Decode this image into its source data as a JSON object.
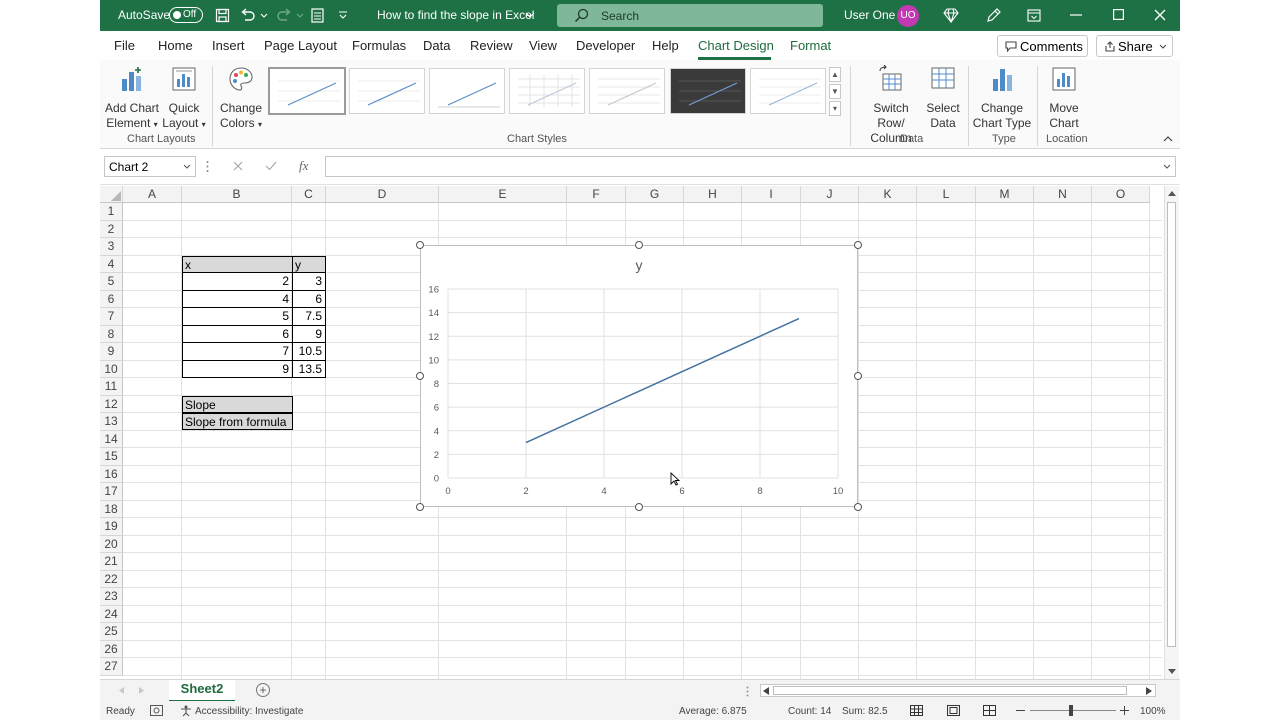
{
  "titlebar": {
    "autosave_label": "AutoSave",
    "autosave_state": "Off",
    "doc_title": "How to find the slope in Excel",
    "search_placeholder": "Search",
    "user_name": "User One",
    "user_initials": "UO"
  },
  "menu": {
    "tabs": [
      "File",
      "Home",
      "Insert",
      "Page Layout",
      "Formulas",
      "Data",
      "Review",
      "View",
      "Developer",
      "Help",
      "Chart Design",
      "Format"
    ],
    "active_tab": "Chart Design",
    "comments_label": "Comments",
    "share_label": "Share"
  },
  "ribbon": {
    "add_chart_element": [
      "Add Chart",
      "Element"
    ],
    "quick_layout": [
      "Quick",
      "Layout"
    ],
    "change_colors": [
      "Change",
      "Colors"
    ],
    "switch_row_column": [
      "Switch Row/",
      "Column"
    ],
    "select_data": [
      "Select",
      "Data"
    ],
    "change_chart_type": [
      "Change",
      "Chart Type"
    ],
    "move_chart": [
      "Move",
      "Chart"
    ],
    "groups": {
      "chart_layouts": "Chart Layouts",
      "chart_styles": "Chart Styles",
      "data": "Data",
      "type": "Type",
      "location": "Location"
    }
  },
  "formula_bar": {
    "name_box": "Chart 2",
    "fx_label": "fx",
    "formula": ""
  },
  "grid": {
    "columns": [
      "A",
      "B",
      "C",
      "D",
      "E",
      "F",
      "G",
      "H",
      "I",
      "J",
      "K",
      "L",
      "M",
      "N",
      "O"
    ],
    "rows": [
      "1",
      "2",
      "3",
      "4",
      "5",
      "6",
      "7",
      "8",
      "9",
      "10",
      "11",
      "12",
      "13",
      "14",
      "15",
      "16",
      "17",
      "18",
      "19",
      "20",
      "21",
      "22",
      "23",
      "24",
      "25",
      "26",
      "27"
    ],
    "table": {
      "header_x": "x",
      "header_y": "y",
      "x_values": [
        "2",
        "4",
        "5",
        "6",
        "7",
        "9"
      ],
      "y_values": [
        "3",
        "6",
        "7.5",
        "9",
        "10.5",
        "13.5"
      ],
      "slope_label": "Slope",
      "slope_formula_label": "Slope from formula"
    }
  },
  "chart_data": {
    "type": "line",
    "title": "y",
    "x": [
      2,
      4,
      5,
      6,
      7,
      9
    ],
    "series": [
      {
        "values": [
          3,
          6,
          7.5,
          9,
          10.5,
          13.5
        ],
        "color": "#44719f"
      }
    ],
    "xlim": [
      0,
      10
    ],
    "ylim": [
      0,
      16
    ],
    "x_ticks": [
      0,
      2,
      4,
      6,
      8,
      10
    ],
    "y_ticks": [
      0,
      2,
      4,
      6,
      8,
      10,
      12,
      14,
      16
    ],
    "grid": true
  },
  "sheet_tabs": {
    "active": "Sheet2",
    "add_label": "+"
  },
  "status_bar": {
    "ready": "Ready",
    "accessibility": "Accessibility: Investigate",
    "average": "Average: 6.875",
    "count": "Count: 14",
    "sum": "Sum: 82.5",
    "zoom": "100%"
  },
  "colors": {
    "excel_green": "#1e7145",
    "header_fill": "#d9d9d9",
    "series_line": "#44719f",
    "avatar": "#c239b3"
  }
}
